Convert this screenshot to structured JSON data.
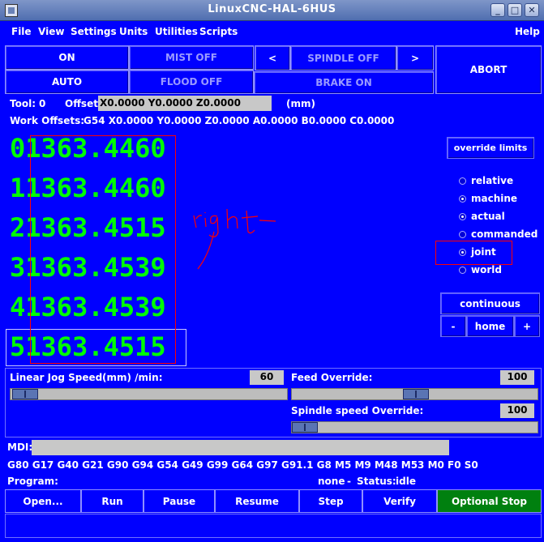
{
  "window": {
    "title": "LinuxCNC-HAL-6HUS"
  },
  "menu": {
    "file": "File",
    "view": "View",
    "settings": "Settings",
    "units": "Units",
    "utilities": "Utilities",
    "scripts": "Scripts",
    "help": "Help"
  },
  "buttons": {
    "on": "ON",
    "mist": "MIST OFF",
    "spindle_left": "<",
    "spindle": "SPINDLE OFF",
    "spindle_right": ">",
    "abort": "ABORT",
    "auto": "AUTO",
    "flood": "FLOOD OFF",
    "brake": "BRAKE ON"
  },
  "tool": {
    "label": "Tool:",
    "value": "0",
    "offset_label": "Offset:",
    "offset_value": "X0.0000 Y0.0000 Z0.0000",
    "units": "(mm)"
  },
  "work_offsets": {
    "label": "Work Offsets:",
    "value": "G54 X0.0000 Y0.0000 Z0.0000 A0.0000 B0.0000 C0.0000"
  },
  "dro": {
    "rows": [
      {
        "axis": "0",
        "value": "1363.4460"
      },
      {
        "axis": "1",
        "value": "1363.4460"
      },
      {
        "axis": "2",
        "value": "1363.4515"
      },
      {
        "axis": "3",
        "value": "1363.4539"
      },
      {
        "axis": "4",
        "value": "1363.4539"
      },
      {
        "axis": "5",
        "value": "1363.4515"
      }
    ]
  },
  "annotation": {
    "text": "right",
    "color": "#ff0000"
  },
  "display": {
    "override_limits": "override limits",
    "options": [
      {
        "label": "relative",
        "selected": false
      },
      {
        "label": "machine",
        "selected": true
      },
      {
        "label": "actual",
        "selected": true
      },
      {
        "label": "commanded",
        "selected": false
      },
      {
        "label": "joint",
        "selected": true
      },
      {
        "label": "world",
        "selected": false
      }
    ]
  },
  "jog": {
    "mode": "continuous",
    "minus": "-",
    "home": "home",
    "plus": "+"
  },
  "linear_jog": {
    "label": "Linear Jog Speed",
    "units": "(mm) /min:",
    "value": "60"
  },
  "feed_override": {
    "label": "Feed Override:",
    "value": "100"
  },
  "spindle_override": {
    "label": "Spindle speed Override:",
    "value": "100"
  },
  "mdi": {
    "label": "MDI:",
    "value": ""
  },
  "gcodes": "G80 G17 G40 G21 G90 G94 G54 G49 G99 G64 G97 G91.1 G8 M5 M9 M48 M53 M0 F0 S0",
  "program": {
    "label": "Program:",
    "value": "none",
    "sep": "-",
    "status_label": "Status:",
    "status_value": "idle"
  },
  "bottom": {
    "open": "Open...",
    "run": "Run",
    "pause": "Pause",
    "resume": "Resume",
    "step": "Step",
    "verify": "Verify",
    "optional_stop": "Optional Stop"
  },
  "colors": {
    "background": "#0000ff",
    "dro_text": "#00ff00",
    "optional_stop": "#00800f",
    "highlight_box": "#ff0000"
  }
}
